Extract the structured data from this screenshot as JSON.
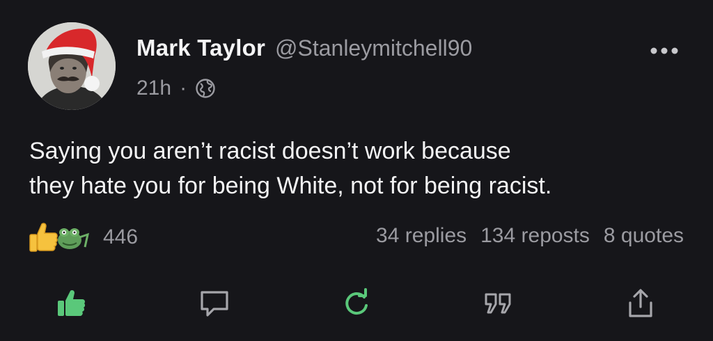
{
  "author": {
    "display_name": "Mark Taylor",
    "handle": "@Stanleymitchell90"
  },
  "meta": {
    "time": "21h",
    "separator": "·",
    "visibility_icon": "globe-icon"
  },
  "post": {
    "lines": [
      "Saying you aren’t racist doesn’t work because",
      "they hate you for being White, not for being racist."
    ]
  },
  "reactions": {
    "count": "446",
    "icons": [
      "thumbs-up-emoji-icon",
      "frog-emoji-icon"
    ]
  },
  "stats": {
    "replies": "34 replies",
    "reposts": "134 reposts",
    "quotes": "8 quotes"
  },
  "actions": [
    {
      "name": "like",
      "icon": "thumbs-up-icon",
      "color": "#5ac87a"
    },
    {
      "name": "reply",
      "icon": "comment-icon",
      "color": "#a6a6ab"
    },
    {
      "name": "repost",
      "icon": "refresh-icon",
      "color": "#5ac87a"
    },
    {
      "name": "quote",
      "icon": "quote-icon",
      "color": "#a6a6ab"
    },
    {
      "name": "share",
      "icon": "share-icon",
      "color": "#a6a6ab"
    }
  ],
  "colors": {
    "background": "#16161a",
    "text": "#f4f4f5",
    "muted": "#9b9ba1",
    "accent": "#5ac87a"
  }
}
